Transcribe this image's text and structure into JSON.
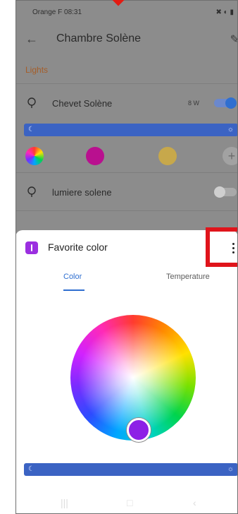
{
  "status": {
    "carrier_time": "Orange F 08:31",
    "icons": "✖ ◐ ▮"
  },
  "header": {
    "title": "Chambre Solène"
  },
  "section": {
    "lights_label": "Lights"
  },
  "lights": [
    {
      "name": "Chevet Solène",
      "power": "8 W",
      "on": true
    },
    {
      "name": "lumiere solene",
      "power": "",
      "on": false
    }
  ],
  "swatches": [
    {
      "color": "#b9108f"
    },
    {
      "color": "#c7a84b"
    }
  ],
  "sheet": {
    "title": "Favorite color",
    "tabs": {
      "color": "Color",
      "temperature": "Temperature"
    },
    "selected_tab": "Color",
    "selected_color": "#8d20e6"
  },
  "colors": {
    "accent_blue": "#2f6fd0",
    "slider_blue": "#3b63c3",
    "highlight_red": "#e0141b"
  }
}
